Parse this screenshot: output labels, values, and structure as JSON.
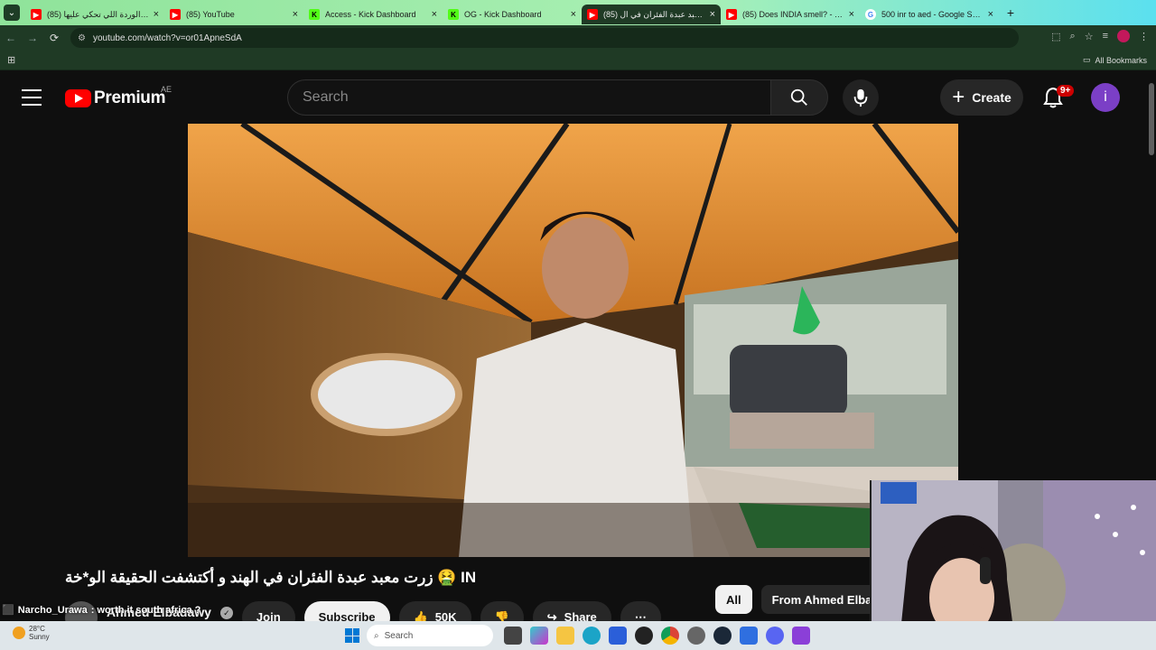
{
  "browser": {
    "tabs": [
      {
        "title": "(85) الوردة اللي تحكي عليها .be",
        "favicon": "youtube",
        "active": false
      },
      {
        "title": "(85) YouTube",
        "favicon": "youtube",
        "active": false
      },
      {
        "title": "Access - Kick Dashboard",
        "favicon": "kick",
        "active": false
      },
      {
        "title": "OG - Kick Dashboard",
        "favicon": "kick",
        "active": false
      },
      {
        "title": "(85) زرت معبد عبدة الفئران في ال",
        "favicon": "youtube",
        "active": true
      },
      {
        "title": "(85) Does INDIA smell? - You",
        "favicon": "youtube",
        "active": false
      },
      {
        "title": "500 inr to aed - Google Search",
        "favicon": "google",
        "active": false
      }
    ],
    "url": "youtube.com/watch?v=or01ApneSdA",
    "bookmarks_label": "All Bookmarks"
  },
  "youtube": {
    "logo_text": "Premium",
    "region": "AE",
    "search_placeholder": "Search",
    "create_label": "Create",
    "notification_badge": "9+",
    "avatar_letter": "i",
    "video_title": "زرت معبد عبدة الفئران في الهند و أكتشفت الحقيقة الو*خة 🤮 IN",
    "channel_name": "Ahmed Elbadawy",
    "join_label": "Join",
    "subscribe_label": "Subscribe",
    "likes": "50K",
    "share_label": "Share",
    "chips": [
      "All",
      "From Ahmed Elba"
    ]
  },
  "chat_overlay": {
    "user": "Narcho_Urawa",
    "message": ": worth it south africa ?"
  },
  "taskbar": {
    "temperature": "28°C",
    "condition": "Sunny",
    "search_label": "Search"
  },
  "colors": {
    "yt_red": "#ff0000",
    "tab_gradient_start": "#8fe39a",
    "chrome_bar": "#1f3a25"
  }
}
